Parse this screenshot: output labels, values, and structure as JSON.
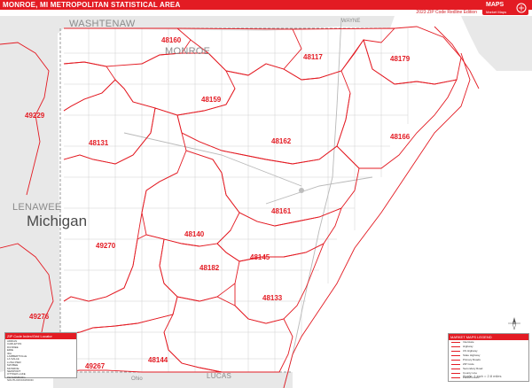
{
  "header": {
    "title": "MONROE, MI METROPOLITAN STATISTICAL AREA",
    "edition": "2023 ZIP Code Redline Edition",
    "logo_brand": "MAPS",
    "logo_sub": "Market Maps"
  },
  "map": {
    "state_label": "Michigan",
    "county_labels": [
      "WASHTENAW",
      "MONROE",
      "LENAWEE",
      "LUCAS"
    ],
    "small_labels": [
      "WAYNE",
      "Ohio"
    ],
    "zip_labels": [
      "48160",
      "48117",
      "48179",
      "49229",
      "48159",
      "48131",
      "48162",
      "48166",
      "48161",
      "49270",
      "48140",
      "48145",
      "48182",
      "48133",
      "49276",
      "48144",
      "49267"
    ],
    "colors": {
      "boundary": "#e31b23",
      "road": "#c8c8c8",
      "county_line": "#9a9a9a",
      "water": "#ffffff",
      "shade": "#e8e8e8"
    }
  },
  "legend": {
    "title": "ZIP Code Index/Grid Locator",
    "rows": [
      "ADRIAN",
      "CARLETON",
      "DUNDEE",
      "ERIE",
      "IDA",
      "LAMBERTVILLE",
      "LA SALLE",
      "LUNA PIER",
      "MAYBEE",
      "MONROE",
      "NEWPORT",
      "OTTAWA LAKE",
      "PETERSBURG",
      "SOUTH ROCKWOOD",
      "TEMPERANCE"
    ]
  },
  "legend2": {
    "title": "MARKET MAPS LEGEND",
    "items": [
      "Interstate",
      "Highway",
      "US Highway",
      "State Highway",
      "Primary Roads",
      "ZIP Code",
      "Secondary Road",
      "County Line",
      "Parks/Forests",
      "Water",
      "Urban Area"
    ]
  },
  "scale": {
    "text": "Scale: 1 inch = 2.8 miles"
  }
}
